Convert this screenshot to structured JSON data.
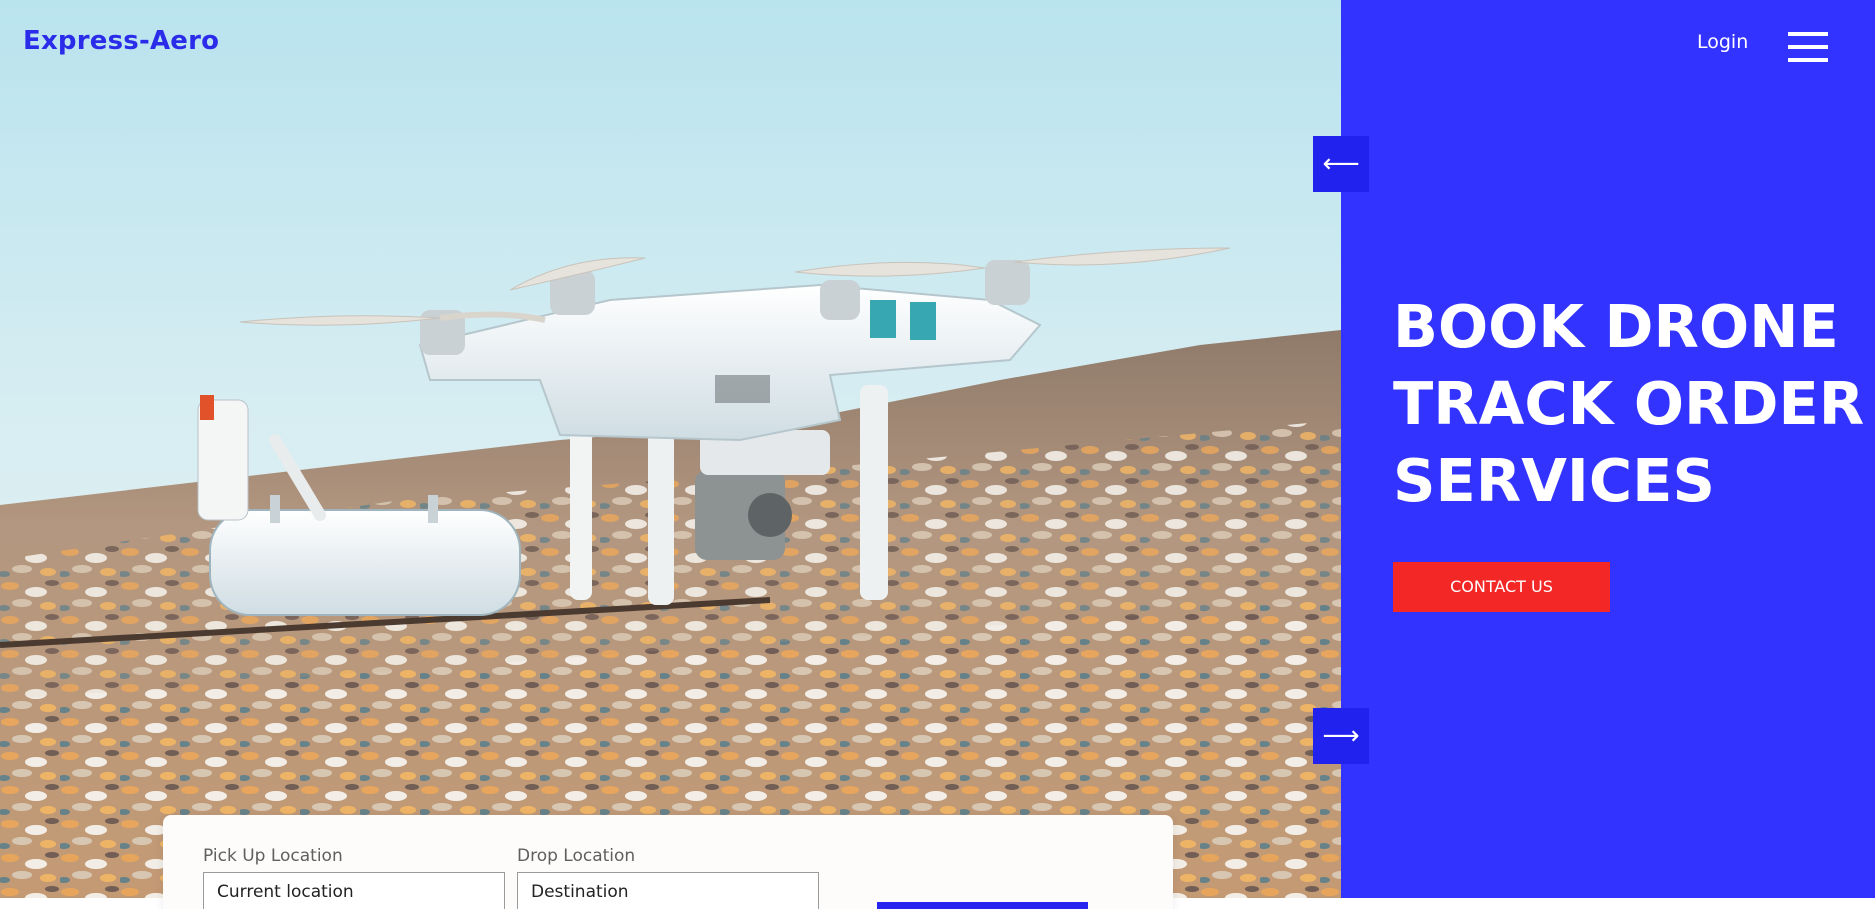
{
  "brand": {
    "name": "Express-Aero",
    "color": "#2b2bea"
  },
  "nav": {
    "login_label": "Login",
    "menu_icon": "hamburger-menu-icon"
  },
  "slider": {
    "prev_icon": "arrow-left-icon",
    "next_icon": "arrow-right-icon",
    "prev_glyph": "⟵",
    "next_glyph": "⟶"
  },
  "hero": {
    "headline": [
      "BOOK DRONE",
      "TRACK ORDER",
      "SERVICES"
    ],
    "cta_label": "CONTACT US",
    "image": "drone-on-beach-photo"
  },
  "booking": {
    "pickup_label": "Pick Up Location",
    "pickup_value": "Current location",
    "drop_label": "Drop Location",
    "drop_value": "Destination"
  },
  "colors": {
    "panel_blue": "#3333ff",
    "arrow_blue": "#2222ee",
    "cta_red": "#f42727"
  }
}
